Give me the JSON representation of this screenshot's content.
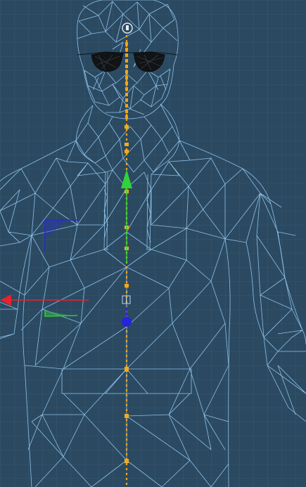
{
  "viewport": {
    "background_color": "#2b4a62",
    "grid_color": "#3d6076",
    "mesh_color": "#8fc1e8",
    "glasses_color": "#111315"
  },
  "rig": {
    "bone_color": "#f2a416",
    "joint_color": "#f5aa1d",
    "root_marker_color": "#e8ecf0"
  },
  "gizmo": {
    "x_axis_color": "#e8222e",
    "y_axis_color": "#31d23a",
    "z_axis_color": "#2424e0",
    "plane_xy_color": "#2b2bd0",
    "plane_xz_color": "#34c53e",
    "pivot_icon": "pivot-square-icon"
  }
}
